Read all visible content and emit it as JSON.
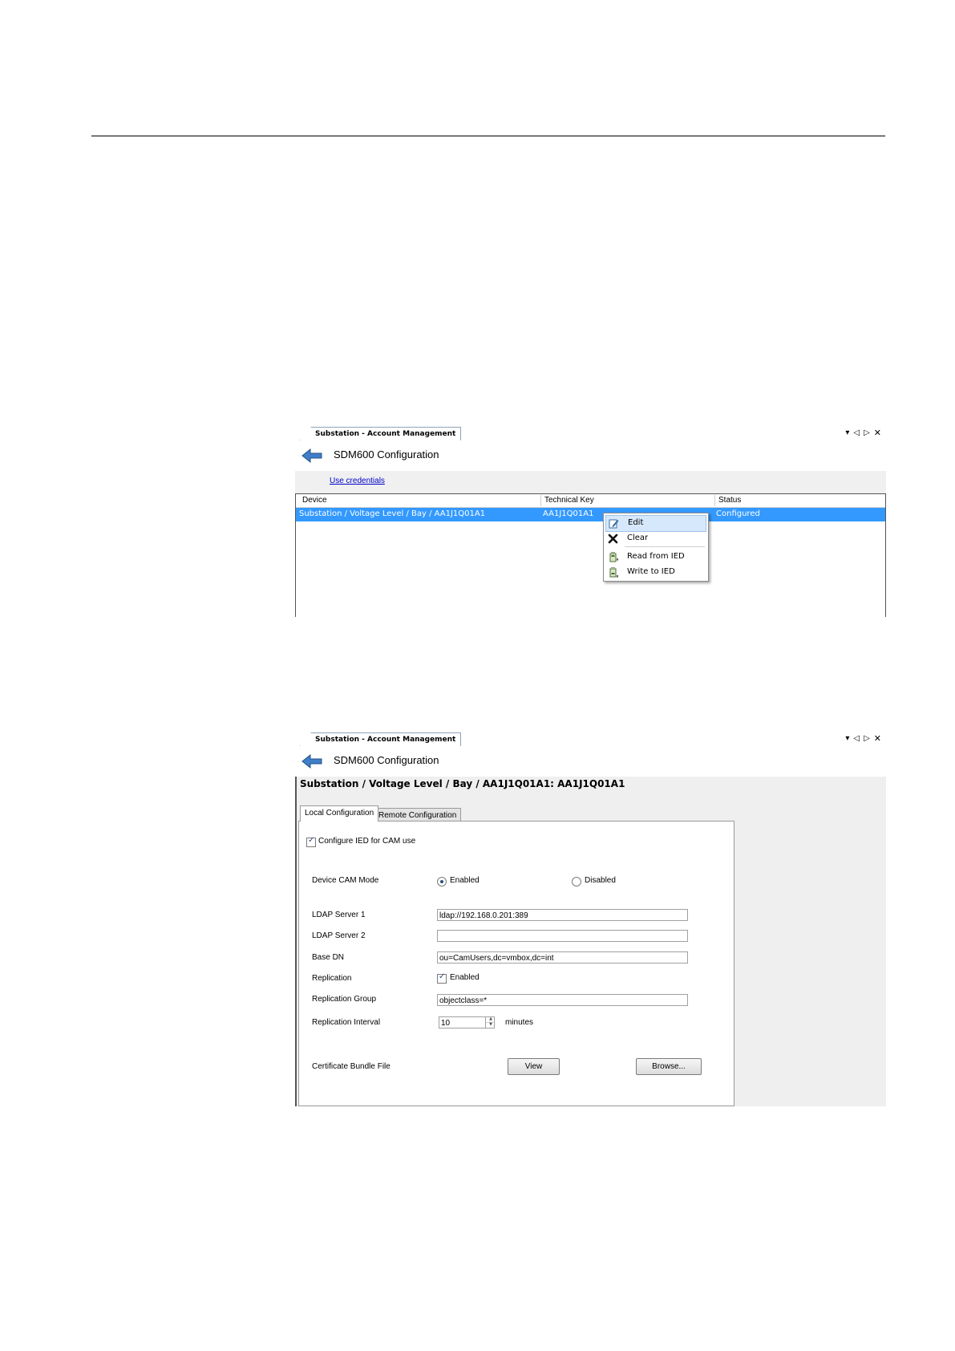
{
  "panel1": {
    "tab_title": "Substation - Account Management",
    "header_title": "SDM600 Configuration",
    "use_credentials": "Use credentials",
    "grid": {
      "columns": [
        "Device",
        "Technical Key",
        "Status"
      ],
      "row": {
        "device": "Substation / Voltage Level / Bay / AA1J1Q01A1",
        "technical_key": "AA1J1Q01A1",
        "status": "Configured"
      }
    },
    "context_menu": {
      "items": [
        {
          "label": "Edit",
          "icon": "edit-icon"
        },
        {
          "label": "Clear",
          "icon": "clear-x-icon"
        },
        {
          "label": "Read from IED",
          "icon": "read-ied-icon"
        },
        {
          "label": "Write to IED",
          "icon": "write-ied-icon"
        }
      ]
    }
  },
  "panel2": {
    "tab_title": "Substation - Account Management",
    "header_title": "SDM600 Configuration",
    "device_title": "Substation / Voltage Level / Bay / AA1J1Q01A1: AA1J1Q01A1",
    "tabs": [
      "Local Configuration",
      "Remote Configuration"
    ],
    "configure_ied_label": "Configure IED for CAM use",
    "configure_ied_checked": true,
    "device_cam_mode": {
      "label": "Device CAM Mode",
      "options": [
        "Enabled",
        "Disabled"
      ],
      "selected": "Enabled"
    },
    "ldap_server_1": {
      "label": "LDAP Server 1",
      "value": "ldap://192.168.0.201:389"
    },
    "ldap_server_2": {
      "label": "LDAP Server 2",
      "value": ""
    },
    "base_dn": {
      "label": "Base DN",
      "value": "ou=CamUsers,dc=vmbox,dc=int"
    },
    "replication": {
      "label": "Replication",
      "check_label": "Enabled",
      "checked": true
    },
    "replication_group": {
      "label": "Replication Group",
      "value": "objectclass=*"
    },
    "replication_interval": {
      "label": "Replication Interval",
      "value": "10",
      "unit": "minutes"
    },
    "certificate_bundle": {
      "label": "Certificate Bundle File",
      "view_button": "View",
      "browse_button": "Browse..."
    }
  },
  "colors": {
    "selection": "#3399ff",
    "menu_highlight": "#d6e8fb",
    "link": "#0000cc"
  }
}
